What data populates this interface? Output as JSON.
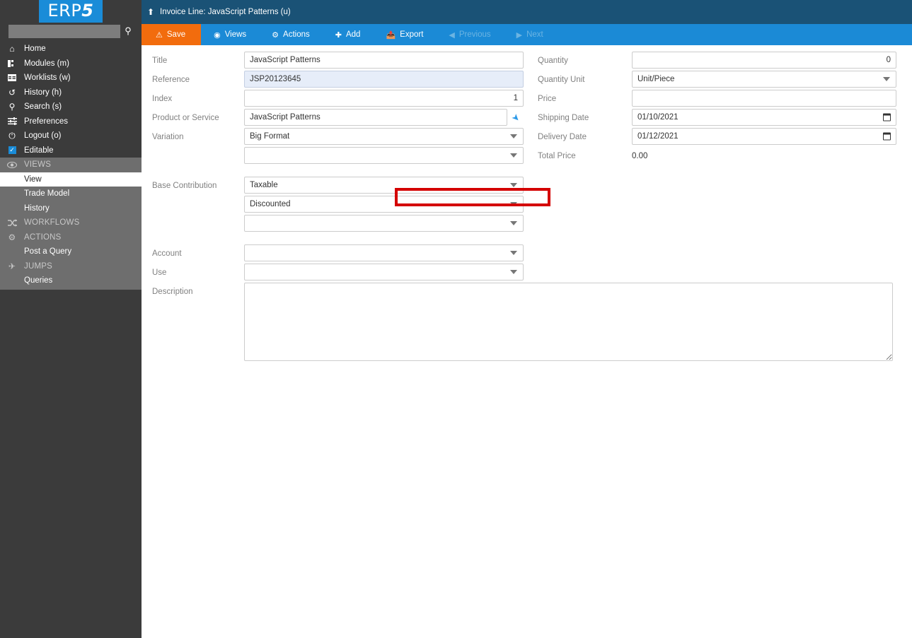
{
  "app": {
    "logo_text": "ERP",
    "logo_suffix": "5"
  },
  "sidebar": {
    "search": {
      "value": "",
      "placeholder": "",
      "icon": "search-icon"
    },
    "items": [
      {
        "label": "Home",
        "icon": "home-icon",
        "glyph": "⌂"
      },
      {
        "label": "Modules (m)",
        "icon": "modules-icon",
        "glyph": "⚒"
      },
      {
        "label": "Worklists (w)",
        "icon": "worklists-icon",
        "glyph": "≡"
      },
      {
        "label": "History (h)",
        "icon": "history-icon",
        "glyph": "↺"
      },
      {
        "label": "Search (s)",
        "icon": "search-icon",
        "glyph": "⌕"
      },
      {
        "label": "Preferences",
        "icon": "sliders-icon",
        "glyph": "☰"
      },
      {
        "label": "Logout (o)",
        "icon": "power-icon",
        "glyph": "⏻"
      },
      {
        "label": "Editable",
        "icon": "checkbox-checked-icon",
        "glyph": "✓"
      }
    ],
    "sub_items": [
      {
        "label": "VIEWS",
        "icon": "eye-icon",
        "glyph": "◉",
        "type": "section",
        "active": false
      },
      {
        "label": "View",
        "icon": "",
        "glyph": "",
        "type": "link",
        "active": true
      },
      {
        "label": "Trade Model",
        "icon": "",
        "glyph": "",
        "type": "link",
        "active": false
      },
      {
        "label": "History",
        "icon": "",
        "glyph": "",
        "type": "link",
        "active": false
      },
      {
        "label": "WORKFLOWS",
        "icon": "shuffle-icon",
        "glyph": "⤨",
        "type": "section",
        "active": false
      },
      {
        "label": "ACTIONS",
        "icon": "gear-icon",
        "glyph": "⚙",
        "type": "section",
        "active": false
      },
      {
        "label": "Post a Query",
        "icon": "",
        "glyph": "",
        "type": "link",
        "active": false
      },
      {
        "label": "JUMPS",
        "icon": "plane-icon",
        "glyph": "✈",
        "type": "section",
        "active": false
      },
      {
        "label": "Queries",
        "icon": "",
        "glyph": "",
        "type": "link",
        "active": false
      }
    ]
  },
  "header": {
    "up_icon": "arrow-up-icon",
    "title": "Invoice Line: JavaScript Patterns (u)"
  },
  "toolbar": {
    "save_label": "Save",
    "save_icon": "warning-triangle-icon",
    "views_label": "Views",
    "views_icon": "eye-icon",
    "actions_label": "Actions",
    "actions_icon": "gear-icon",
    "add_label": "Add",
    "add_icon": "plus-icon",
    "export_label": "Export",
    "export_icon": "export-icon",
    "previous_label": "Previous",
    "previous_icon": "chevron-left-icon",
    "next_label": "Next",
    "next_icon": "chevron-right-icon"
  },
  "form": {
    "left": {
      "title_label": "Title",
      "title_value": "JavaScript Patterns",
      "reference_label": "Reference",
      "reference_value": "JSP20123645",
      "index_label": "Index",
      "index_value": "1",
      "product_label": "Product or Service",
      "product_value": "JavaScript Patterns",
      "product_pin_icon": "pin-icon",
      "variation_label": "Variation",
      "variation_value_1": "Big Format",
      "variation_value_2": "",
      "base_contribution_label": "Base Contribution",
      "base_contribution_value_1": "Taxable",
      "base_contribution_value_2": "Discounted",
      "base_contribution_value_3": "",
      "account_label": "Account",
      "account_value": "",
      "use_label": "Use",
      "use_value": "",
      "description_label": "Description",
      "description_value": ""
    },
    "right": {
      "quantity_label": "Quantity",
      "quantity_value": "0",
      "quantity_unit_label": "Quantity Unit",
      "quantity_unit_value": "Unit/Piece",
      "price_label": "Price",
      "price_value": "",
      "shipping_date_label": "Shipping Date",
      "shipping_date_value": "01/10/2021",
      "delivery_date_label": "Delivery Date",
      "delivery_date_value": "01/12/2021",
      "total_price_label": "Total Price",
      "total_price_value": "0.00"
    }
  },
  "annotation": {
    "target": "variation-select-1",
    "color": "#d40000"
  },
  "colors": {
    "sidebar_bg": "#3b3b3b",
    "sidebar_sub_bg": "#6e6e6e",
    "header_bg": "#1a5276",
    "toolbar_bg": "#1b8ad6",
    "save_bg": "#f26c0d",
    "logo_bg": "#1a8cd8",
    "field_highlight": "#e6edf9",
    "annotation": "#d40000"
  }
}
